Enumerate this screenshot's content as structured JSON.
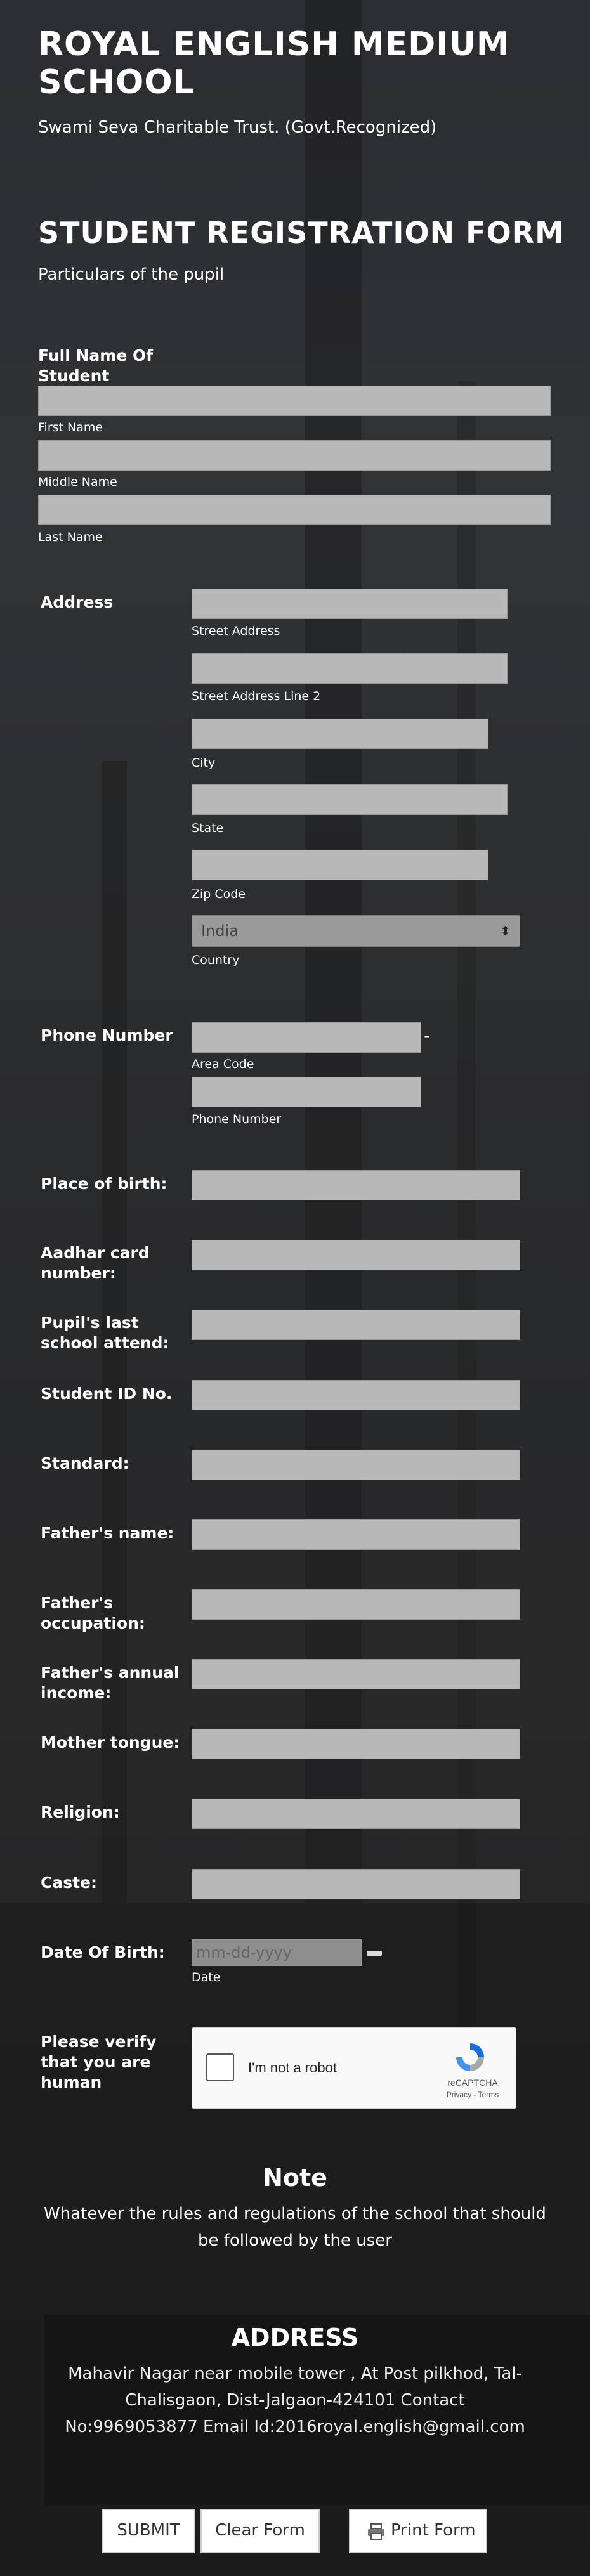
{
  "school": {
    "name": "ROYAL ENGLISH MEDIUM SCHOOL",
    "subtitle": "Swami Seva Charitable Trust. (Govt.Recognized)"
  },
  "form": {
    "title": "STUDENT REGISTRATION FORM",
    "section": "Particulars of the pupil",
    "full_name": {
      "label": "Full Name Of Student",
      "first": "First Name",
      "middle": "Middle Name",
      "last": "Last Name"
    },
    "address": {
      "label": "Address",
      "street": "Street Address",
      "street2": "Street Address Line 2",
      "city": "City",
      "state": "State",
      "zip": "Zip Code",
      "country_value": "India",
      "country": "Country"
    },
    "phone": {
      "label": "Phone Number",
      "area": "Area Code",
      "number": "Phone Number",
      "dash": "-"
    },
    "fields": {
      "place_of_birth": "Place of birth:",
      "aadhar": "Aadhar card number:",
      "last_school": "Pupil's last school attend:",
      "student_id": "Student ID No.",
      "standard": "Standard:",
      "father_name": "Father's name:",
      "father_occupation": "Father's occupation:",
      "father_income": "Father's annual income:",
      "mother_tongue": "Mother tongue:",
      "religion": "Religion:",
      "caste": "Caste:"
    },
    "dob": {
      "label": "Date Of Birth:",
      "placeholder": "mm-dd-yyyy",
      "sub": "Date"
    },
    "captcha": {
      "label": "Please verify that you are human",
      "checkbox": "I'm not a robot",
      "brand": "reCAPTCHA",
      "links": "Privacy - Terms"
    },
    "note": {
      "title": "Note",
      "text": "Whatever the rules and regulations of the school that should be followed by the user"
    },
    "address_block": {
      "title": "ADDRESS",
      "text": "Mahavir Nagar near mobile tower , At Post pilkhod, Tal-Chalisgaon, Dist-Jalgaon-424101 Contact No:9969053877 Email Id:2016royal.english@gmail.com"
    },
    "buttons": {
      "submit": "SUBMIT",
      "clear": "Clear Form",
      "print": "Print Form"
    }
  },
  "colors": {
    "field_bg": "#b8b8b8",
    "page_bg": "#2c2e31",
    "captcha_blue": "#1c6fd9"
  }
}
